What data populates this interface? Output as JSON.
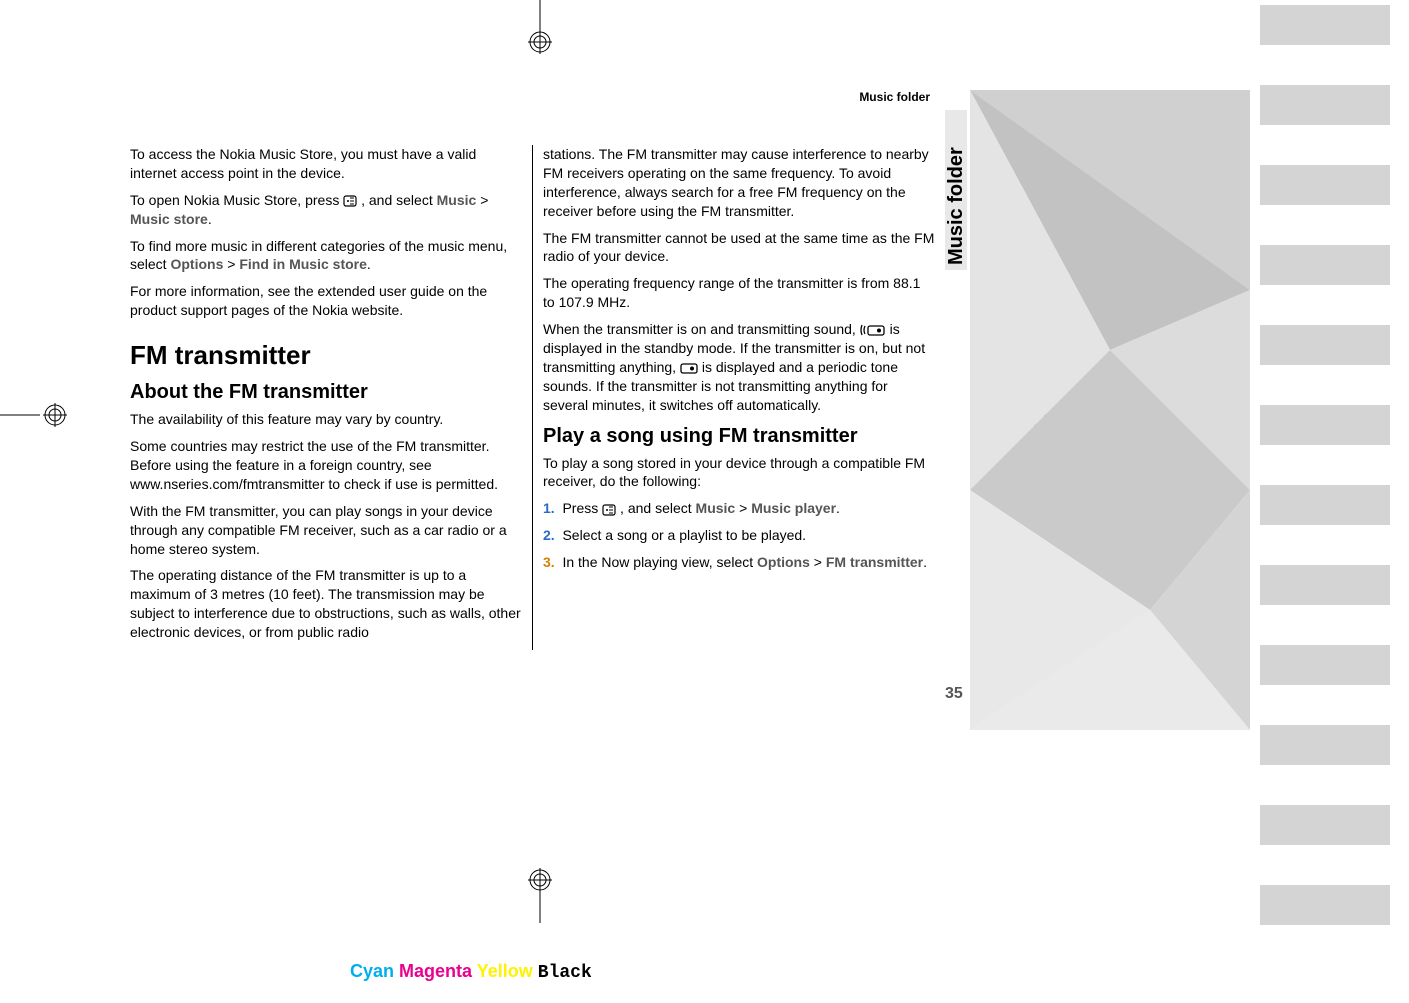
{
  "header": "Music folder",
  "sidebar_label": "Music folder",
  "page_number": "35",
  "left_col": {
    "p1": "To access the Nokia Music Store, you must have a valid internet access point in the device.",
    "p2a": "To open Nokia Music Store, press ",
    "p2b": " , and select ",
    "p2_link1": "Music",
    "p2_gt": " > ",
    "p2_link2": "Music store",
    "p2_end": ".",
    "p3a": "To find more music in different categories of the music menu, select ",
    "p3_link1": "Options",
    "p3_gt": " > ",
    "p3_link2": "Find in Music store",
    "p3_end": ".",
    "p4": "For more information, see the extended user guide on the product support pages of the Nokia website.",
    "h1": "FM transmitter",
    "h2": "About the FM transmitter",
    "p5": "The availability of this feature may vary by country.",
    "p6": "Some countries may restrict the use of the FM transmitter. Before using the feature in a foreign country, see www.nseries.com/fmtransmitter to check if use is permitted.",
    "p7": "With the FM transmitter, you can play songs in your device through any compatible FM receiver, such as a car radio or a home stereo system.",
    "p8": "The operating distance of the FM transmitter is up to a maximum of 3 metres (10 feet). The transmission may be subject to interference due to obstructions, such as walls, other electronic devices, or from public radio"
  },
  "right_col": {
    "p1": "stations. The FM transmitter may cause interference to nearby FM receivers operating on the same frequency. To avoid interference, always search for a free FM frequency on the receiver before using the FM transmitter.",
    "p2": "The FM transmitter cannot be used at the same time as the FM radio of your device.",
    "p3": "The operating frequency range of the transmitter is from 88.1 to 107.9 MHz.",
    "p4a": "When the transmitter is on and transmitting sound, ",
    "p4b": " is displayed in the standby mode. If the transmitter is on, but not transmitting anything, ",
    "p4c": " is displayed and a periodic tone sounds. If the transmitter is not transmitting anything for several minutes, it switches off automatically.",
    "h2": "Play a song using FM transmitter",
    "p5": "To play a song stored in your device through a compatible FM receiver, do the following:",
    "step1a": "Press ",
    "step1b": " , and select ",
    "step1_link1": "Music",
    "step1_gt": " > ",
    "step1_link2": "Music player",
    "step1_end": ".",
    "step2": "Select a song or a playlist to be played.",
    "step3a": "In the Now playing view, select ",
    "step3_link1": "Options",
    "step3_gt": " > ",
    "step3_link2": "FM transmitter",
    "step3_end": "."
  },
  "list_markers": {
    "n1": "1.",
    "n2": "2.",
    "n3": "3."
  },
  "cmyk": {
    "cyan": "Cyan",
    "magenta": "Magenta",
    "yellow": "Yellow",
    "black": "Black"
  }
}
